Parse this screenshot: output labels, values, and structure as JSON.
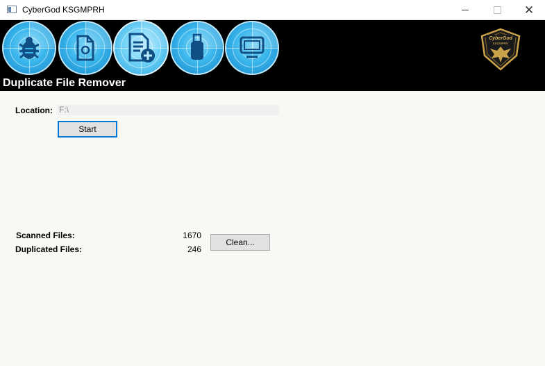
{
  "window": {
    "title": "CyberGod KSGMPRH",
    "controls": {
      "minimize": "",
      "maximize": "",
      "close": "✕"
    }
  },
  "header": {
    "title": "Duplicate File Remover",
    "nav": [
      {
        "name": "antivirus",
        "icon": "bug-icon",
        "active": false
      },
      {
        "name": "file-scan",
        "icon": "document-icon",
        "active": false
      },
      {
        "name": "duplicate-remover",
        "icon": "add-document-icon",
        "active": true
      },
      {
        "name": "usb",
        "icon": "usb-drive-icon",
        "active": false
      },
      {
        "name": "system",
        "icon": "monitor-icon",
        "active": false
      }
    ],
    "logo_text": "CyberGod KSGMPRH",
    "colors": {
      "bar": "#000000",
      "accent": "#39b6ec",
      "logo_gold": "#c9a24a"
    }
  },
  "location": {
    "label": "Location:",
    "value": "F:\\"
  },
  "start_label": "Start",
  "stats": {
    "scanned_label": "Scanned Files:",
    "scanned_value": "1670",
    "duplicated_label": "Duplicated Files:",
    "duplicated_value": "246"
  },
  "clean_label": "Clean..."
}
